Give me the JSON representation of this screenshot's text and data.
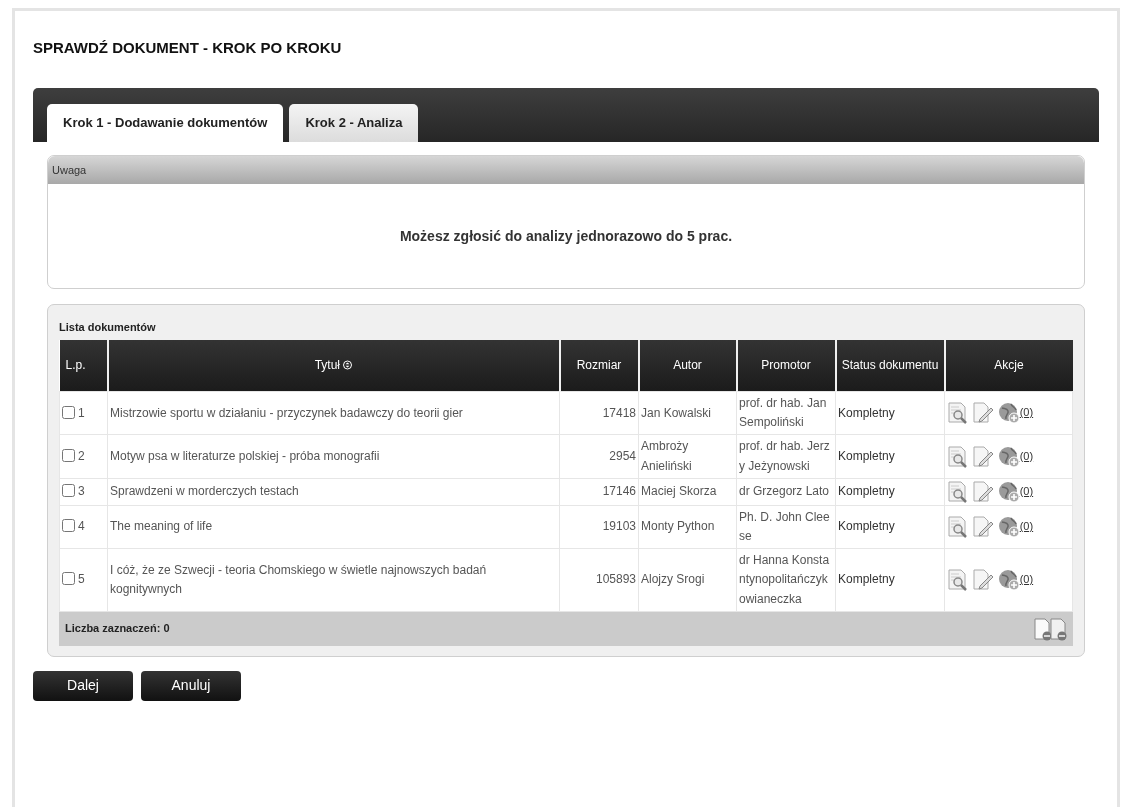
{
  "page_title": "SPRAWDŹ DOKUMENT - KROK PO KROKU",
  "tabs": [
    {
      "label": "Krok 1 - Dodawanie dokumentów",
      "selected": true
    },
    {
      "label": "Krok 2 - Analiza",
      "selected": false
    }
  ],
  "notice": {
    "title": "Uwaga",
    "message": "Możesz zgłosić do analizy jednorazowo do 5 prac."
  },
  "documents": {
    "title": "Lista dokumentów",
    "columns": [
      "L.p.",
      "Tytuł",
      "Rozmiar",
      "Autor",
      "Promotor",
      "Status dokumentu",
      "Akcje"
    ],
    "rows": [
      {
        "number": "1",
        "checked": false,
        "title": "Mistrzowie sportu w działaniu - przyczynek badawczy do teorii gier",
        "size": "17418",
        "author": "Jan Kowalski",
        "promoter": "prof. dr hab. Jan Sempoliński",
        "status": "Kompletny",
        "count": "(0)"
      },
      {
        "number": "2",
        "checked": false,
        "title": "Motyw psa w literaturze polskiej - próba monografii",
        "size": "2954",
        "author": "Ambroży Anieliński",
        "promoter": "prof. dr hab. Jerzy Jeżynowski",
        "status": "Kompletny",
        "count": "(0)"
      },
      {
        "number": "3",
        "checked": false,
        "title": "Sprawdzeni w morderczych testach",
        "size": "17146",
        "author": "Maciej Skorza",
        "promoter": "dr Grzegorz Lato",
        "status": "Kompletny",
        "count": "(0)"
      },
      {
        "number": "4",
        "checked": false,
        "title": "The meaning of life",
        "size": "19103",
        "author": "Monty Python",
        "promoter": "Ph. D. John Cleese",
        "status": "Kompletny",
        "count": "(0)"
      },
      {
        "number": "5",
        "checked": false,
        "title": "I cóż, że ze Szwecji - teoria Chomskiego w świetle najnowszych badań kognitywnych",
        "size": "105893",
        "author": "Alojzy Srogi",
        "promoter": "dr Hanna Konstantynopolitańczykowianeczka",
        "status": "Kompletny",
        "count": "(0)"
      }
    ],
    "footer": "Liczba zaznaczeń: 0"
  },
  "buttons": [
    "Dalej",
    "Anuluj"
  ]
}
